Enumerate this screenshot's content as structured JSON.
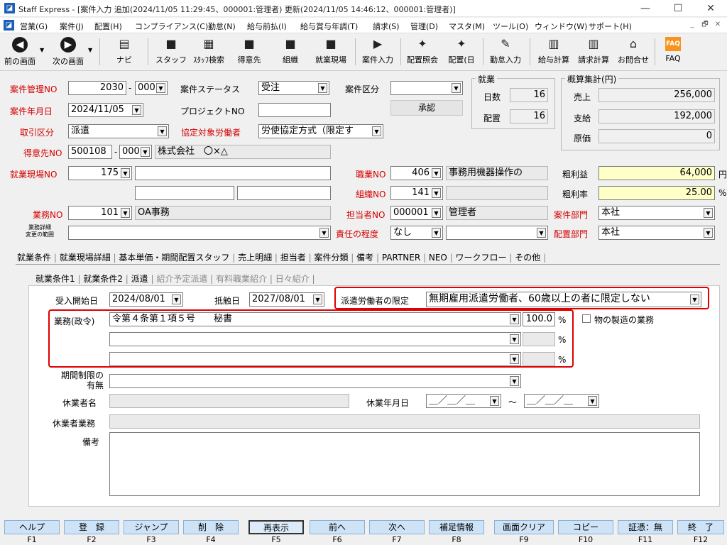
{
  "window": {
    "title": "Staff Express - [案件入力 追加(2024/11/05 11:29:45、000001:管理者) 更新(2024/11/05 14:46:12、000001:管理者)]",
    "minimize": "—",
    "maximize": "☐",
    "close": "✕"
  },
  "menu": [
    "営業(G)",
    "案件(J)",
    "配置(H)",
    "コンプライアンス(C)",
    "勤怠(N)",
    "給与前払(I)",
    "給与賞与年調(T)",
    "請求(S)",
    "管理(D)",
    "マスタ(M)",
    "ツール(O)",
    "ウィンドウ(W)",
    "サポート(H)"
  ],
  "mdi": {
    "min": "_",
    "restore": "🗗",
    "close": "✕"
  },
  "toolbar": [
    {
      "label": "前の画面",
      "icon": "arrow-left-icon",
      "glyph": "◀"
    },
    {
      "label": "次の画面",
      "icon": "arrow-right-icon",
      "glyph": "▶"
    },
    {
      "label": "ナビ",
      "icon": "navi-icon",
      "glyph": "▤"
    },
    {
      "label": "スタッフ",
      "icon": "staff-icon",
      "glyph": "■"
    },
    {
      "label": "ｽﾀｯﾌ検索",
      "icon": "staff-search-icon",
      "glyph": "▦"
    },
    {
      "label": "得意先",
      "icon": "customer-icon",
      "glyph": "■"
    },
    {
      "label": "組織",
      "icon": "organization-icon",
      "glyph": "■"
    },
    {
      "label": "就業現場",
      "icon": "worksite-icon",
      "glyph": "■"
    },
    {
      "label": "案件入力",
      "icon": "case-input-icon",
      "glyph": "▶"
    },
    {
      "label": "配置照会",
      "icon": "placement-inquiry-icon",
      "glyph": "✦"
    },
    {
      "label": "配置(日",
      "icon": "placement-daily-icon",
      "glyph": "✦"
    },
    {
      "label": "勤怠入力",
      "icon": "attendance-icon",
      "glyph": "✎"
    },
    {
      "label": "給与計算",
      "icon": "payroll-icon",
      "glyph": "▥"
    },
    {
      "label": "請求計算",
      "icon": "billing-icon",
      "glyph": "▥"
    },
    {
      "label": "お問合せ",
      "icon": "inquiry-icon",
      "glyph": "⌂"
    },
    {
      "label": "FAQ",
      "icon": "faq-icon",
      "glyph": "FAQ"
    }
  ],
  "form": {
    "case_no_label": "案件管理NO",
    "case_no": "2030",
    "case_no_sub": "000",
    "case_status_label": "案件ステータス",
    "case_status": "受注",
    "case_type_label": "案件区分",
    "case_type": "",
    "case_date_label": "案件年月日",
    "case_date": "2024/11/05",
    "project_label": "プロジェクトNO",
    "project": "",
    "approve_button": "承認",
    "deal_type_label": "取引区分",
    "deal_type": "派遣",
    "agreement_label": "協定対象労働者",
    "agreement": "労使協定方式（限定す",
    "customer_label": "得意先NO",
    "customer_no": "500108",
    "customer_sub": "000",
    "customer_name": "株式会社　〇×△",
    "site_label": "就業現場NO",
    "site_no": "175",
    "job_label": "職業NO",
    "job_no": "406",
    "job_name": "事務用機器操作の",
    "org_label": "組織NO",
    "org_no": "141",
    "org_name": "",
    "work_label": "業務NO",
    "work_no": "101",
    "work_name": "OA事務",
    "staff_label": "担当者NO",
    "staff_no": "000001",
    "staff_name": "管理者",
    "case_dept_label": "案件部門",
    "case_dept": "本社",
    "work_scope_label1": "業務詳細",
    "work_scope_label2": "変更の範囲",
    "responsibility_label": "責任の程度",
    "responsibility": "なし",
    "placement_dept_label": "配置部門",
    "placement_dept": "本社"
  },
  "employment_group": {
    "title": "就業",
    "days_label": "日数",
    "days": "16",
    "placement_label": "配置",
    "placement": "16"
  },
  "estimate_group": {
    "title": "概算集計(円)",
    "sales_label": "売上",
    "sales": "256,000",
    "pay_label": "支給",
    "pay": "192,000",
    "cost_label": "原価",
    "cost": "0"
  },
  "profit": {
    "gross_label": "粗利益",
    "gross": "64,000",
    "gross_unit": "円",
    "rate_label": "粗利率",
    "rate": "25.00",
    "rate_unit": "%"
  },
  "tabs": [
    "就業条件",
    "就業現場詳細",
    "基本単価・期間配置スタッフ",
    "売上明細",
    "担当者",
    "案件分類",
    "備考",
    "PARTNER",
    "NEO",
    "ワークフロー",
    "その他"
  ],
  "subtabs": [
    "就業条件1",
    "就業条件2",
    "派遣",
    "紹介予定派遣",
    "有料職業紹介",
    "日々紹介"
  ],
  "dispatch": {
    "start_label": "受入開始日",
    "start": "2024/08/01",
    "conflict_label": "抵触日",
    "conflict": "2027/08/01",
    "limit_label": "派遣労働者の限定",
    "limit": "無期雇用派遣労働者、60歳以上の者に限定しない",
    "work_gov_label": "業務(政令)",
    "works": [
      {
        "text": "令第４条第１項５号　　秘書",
        "pct": "100.0",
        "unit": "%"
      },
      {
        "text": "",
        "pct": "",
        "unit": "%"
      },
      {
        "text": "",
        "pct": "",
        "unit": "%"
      }
    ],
    "manufacturing_label": "物の製造の業務",
    "period_label1": "期間制限の",
    "period_label2": "有無",
    "period": "",
    "leave_name_label": "休業者名",
    "leave_name": "",
    "leave_date_label": "休業年月日",
    "leave_from": "＿／＿／＿",
    "leave_to": "＿／＿／＿",
    "tilde": "〜",
    "leave_work_label": "休業者業務",
    "leave_work": "",
    "notes_label": "備考",
    "notes": ""
  },
  "fkeys": [
    {
      "label": "ヘルプ",
      "key": "F1"
    },
    {
      "label": "登　録",
      "key": "F2"
    },
    {
      "label": "ジャンプ",
      "key": "F3"
    },
    {
      "label": "削　除",
      "key": "F4"
    },
    {
      "label": "再表示",
      "key": "F5"
    },
    {
      "label": "前へ",
      "key": "F6"
    },
    {
      "label": "次へ",
      "key": "F7"
    },
    {
      "label": "補足情報",
      "key": "F8"
    },
    {
      "label": "画面クリア",
      "key": "F9"
    },
    {
      "label": "コピー",
      "key": "F10"
    },
    {
      "label": "証憑：無",
      "key": "F11"
    },
    {
      "label": "終　了",
      "key": "F12"
    }
  ],
  "colors": {
    "required_label": "#d40000",
    "highlight_box": "#e00000",
    "yellow_field": "#ffffc8",
    "fkey_bg": "#cfe3f7"
  }
}
